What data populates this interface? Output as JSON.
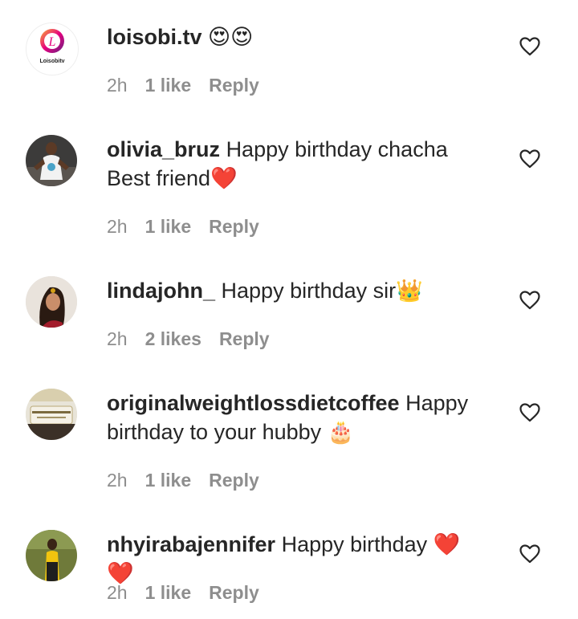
{
  "comments": [
    {
      "username": "loisobi.tv",
      "text": "😍😍",
      "time": "2h",
      "likes": "1 like",
      "reply": "Reply",
      "avatar_label": "Loisobitv",
      "avatar_icon": "loisobi-logo"
    },
    {
      "username": "olivia_bruz",
      "text": "Happy birthday chacha\nBest friend❤️",
      "time": "2h",
      "likes": "1 like",
      "reply": "Reply",
      "avatar_icon": "user-photo"
    },
    {
      "username": "lindajohn_",
      "text": "Happy birthday sir👑",
      "time": "2h",
      "likes": "2 likes",
      "reply": "Reply",
      "avatar_icon": "user-photo"
    },
    {
      "username": "originalweightlossdietcoffee",
      "text": "Happy birthday to your hubby 🎂",
      "time": "2h",
      "likes": "1 like",
      "reply": "Reply",
      "avatar_icon": "product-photo"
    },
    {
      "username": "nhyirabajennifer",
      "text": "Happy birthday ❤️❤️",
      "time": "2h",
      "likes": "1 like",
      "reply": "Reply",
      "avatar_icon": "user-photo"
    }
  ],
  "colors": {
    "text": "#262626",
    "meta": "#8e8e8e",
    "background": "#ffffff"
  }
}
